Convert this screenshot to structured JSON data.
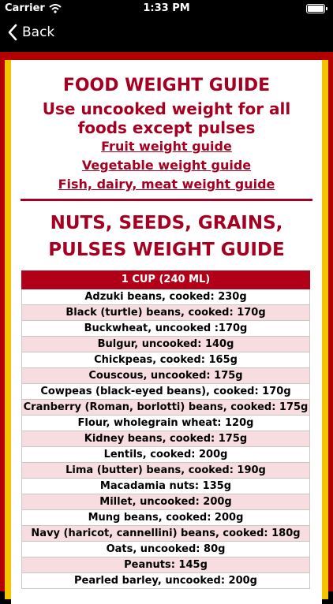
{
  "status": {
    "carrier": "Carrier",
    "time": "1:33 PM"
  },
  "nav": {
    "back_label": "Back"
  },
  "header": {
    "title": "FOOD WEIGHT GUIDE",
    "subtitle_line1": "Use uncooked weight for all",
    "subtitle_line2": "foods except pulses",
    "links": [
      "Fruit weight guide",
      "Vegetable weight guide",
      "Fish, dairy, meat weight guide"
    ]
  },
  "section": {
    "title_line1": "NUTS, SEEDS, GRAINS,",
    "title_line2": "PULSES WEIGHT GUIDE"
  },
  "table": {
    "header": "1 CUP (240 ML)",
    "rows": [
      "Adzuki beans, cooked: 230g",
      "Black (turtle) beans, cooked: 170g",
      "Buckwheat, uncooked :170g",
      "Bulgur, uncooked: 140g",
      "Chickpeas, cooked: 165g",
      "Couscous, uncooked: 175g",
      "Cowpeas (black-eyed beans), cooked: 170g",
      "Cranberry (Roman, borlotti) beans, cooked: 175g",
      "Flour, wholegrain wheat: 120g",
      "Kidney beans, cooked: 175g",
      "Lentils, cooked: 200g",
      "Lima (butter) beans, cooked: 190g",
      "Macadamia nuts: 135g",
      "Millet, uncooked: 200g",
      "Mung beans, cooked: 200g",
      "Navy (haricot, cannellini) beans, cooked: 180g",
      "Oats, uncooked: 80g",
      "Peanuts: 145g",
      "Pearled barley, uncooked: 200g"
    ]
  }
}
